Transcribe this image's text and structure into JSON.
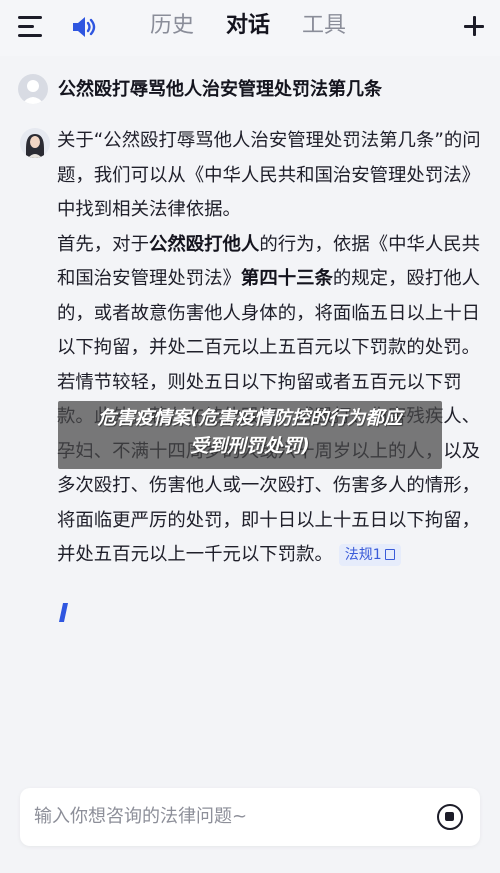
{
  "header": {
    "menu_icon": "menu-icon",
    "speaker_icon": "speaker-icon",
    "tabs": [
      {
        "label": "历史",
        "active": false
      },
      {
        "label": "对话",
        "active": true
      },
      {
        "label": "工具",
        "active": false
      }
    ],
    "plus_icon": "plus-icon"
  },
  "chat": {
    "user_question": "公然殴打辱骂他人治安管理处罚法第几条",
    "answer": {
      "p1": "关于“公然殴打辱骂他人治安管理处罚法第几条”的问题，我们可以从《中华人民共和国治安管理处罚法》中找到相关法律依据。",
      "p2_prefix": "首先，对于",
      "p2_bold1": "公然殴打他人",
      "p2_mid": "的行为，依据《中华人民共和国治安管理处罚法》",
      "p2_bold2": "第四十三条",
      "p2_rest": "的规定，殴打他人的，或者故意伤害他人身体的，将面临五日以上十日以下拘留，并处二百元以上五百元以下罚款的处罚。若情节较轻，则处五日以下拘留或者五百元以下罚款。此外，若存在结伙殴打、或殴打、伤害残疾人、孕妇、不满十四周岁的人或六十周岁以上的人，以及多次殴打、伤害他人或一次殴打、伤害多人的情形，将面临更严厉的处罚，即十日以上十五日以下拘留，并处五百元以上一千元以下罚款。",
      "law_tag": "法规1"
    }
  },
  "watermark": {
    "line1": "危害疫情案(危害疫情防控的行为都应",
    "line2": "受到刑罚处罚)"
  },
  "input": {
    "placeholder": "输入你想咨询的法律问题~",
    "stop_icon": "stop-icon"
  },
  "colors": {
    "accent": "#2f56e0",
    "tag_bg": "#e6ecfb",
    "tag_text": "#3a5bd9",
    "background": "#f3f4f7"
  }
}
